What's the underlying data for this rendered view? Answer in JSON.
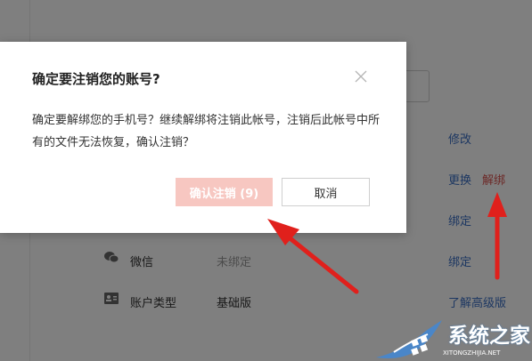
{
  "background_page": {
    "actions": {
      "modify": "修改",
      "replace": "更换",
      "unbind": "解绑",
      "bind_1": "绑定",
      "bind_2": "绑定",
      "upgrade": "了解高级版"
    },
    "rows": [
      {
        "icon": "wechat-icon",
        "label": "微信",
        "value": "未绑定"
      },
      {
        "icon": "id-card-icon",
        "label": "账户类型",
        "value": "基础版"
      }
    ]
  },
  "dialog": {
    "title": "确定要注销您的账号?",
    "message": "确定要解绑您的手机号？继续解绑将注销此帐号，注销后此帐号中所有的文件无法恢复，确认注销？",
    "confirm_label": "确认注销 (9)",
    "cancel_label": "取消"
  },
  "watermark": {
    "name": "系统之家",
    "url": "XITONGZHIJIA.NET"
  },
  "colors": {
    "accent_link": "#3a6fc4",
    "danger": "#d9534f",
    "annotation_arrow": "#e0201c",
    "confirm_disabled": "#f7c7c1"
  }
}
